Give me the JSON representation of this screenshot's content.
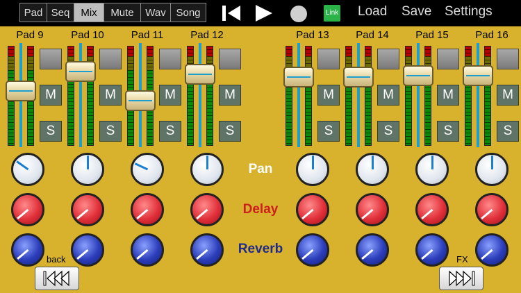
{
  "tabs": [
    {
      "label": "Pad",
      "active": false
    },
    {
      "label": "Seq",
      "active": false
    },
    {
      "label": "Mix",
      "active": true
    },
    {
      "label": "Mute",
      "active": false
    },
    {
      "label": "Wav",
      "active": false
    },
    {
      "label": "Song",
      "active": false
    }
  ],
  "transport": {
    "link_label": "Link"
  },
  "menu": {
    "load": "Load",
    "save": "Save",
    "settings": "Settings"
  },
  "colors": {
    "panel": "#d8b22c",
    "link": "#2bb34a",
    "pan_label": "#ffffff",
    "delay_label": "#cc1f1f",
    "reverb_label": "#1f2a8c"
  },
  "row_labels": {
    "pan": "Pan",
    "delay": "Delay",
    "reverb": "Reverb"
  },
  "nav": {
    "back_label": "back",
    "fx_label": "FX"
  },
  "pads": [
    {
      "label": "Pad 9",
      "mute": "M",
      "solo": "S"
    },
    {
      "label": "Pad 10",
      "mute": "M",
      "solo": "S"
    },
    {
      "label": "Pad 11",
      "mute": "M",
      "solo": "S"
    },
    {
      "label": "Pad 12",
      "mute": "M",
      "solo": "S"
    },
    {
      "label": "Pad 13",
      "mute": "M",
      "solo": "S"
    },
    {
      "label": "Pad 14",
      "mute": "M",
      "solo": "S"
    },
    {
      "label": "Pad 15",
      "mute": "M",
      "solo": "S"
    },
    {
      "label": "Pad 16",
      "mute": "M",
      "solo": "S"
    }
  ]
}
